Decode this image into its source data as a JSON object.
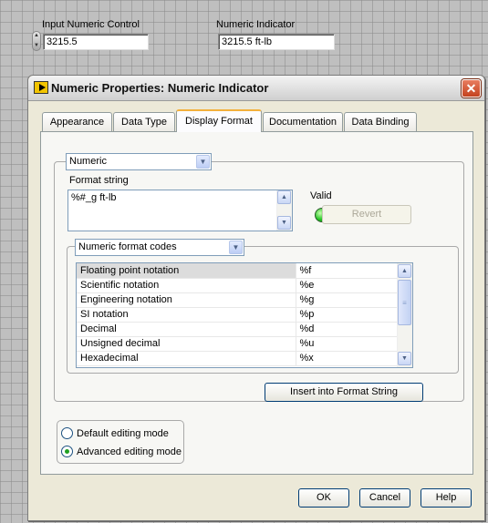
{
  "front_panel": {
    "control_label": "Input Numeric Control",
    "control_value": "3215.5",
    "indicator_label": "Numeric Indicator",
    "indicator_value": "3215.5 ft-lb"
  },
  "dialog": {
    "title": "Numeric Properties: Numeric Indicator",
    "close_glyph": "✕",
    "tabs": [
      "Appearance",
      "Data Type",
      "Display Format",
      "Documentation",
      "Data Binding"
    ],
    "active_tab": "Display Format",
    "type_select": "Numeric",
    "format_string_label": "Format string",
    "format_string_value": "%#_g ft-lb",
    "valid_label": "Valid",
    "valid_led_color": "#22c322",
    "revert_label": "Revert",
    "codes_select": "Numeric format codes",
    "format_codes": [
      {
        "name": "Floating point notation",
        "code": "%f"
      },
      {
        "name": "Scientific notation",
        "code": "%e"
      },
      {
        "name": "Engineering notation",
        "code": "%g"
      },
      {
        "name": "SI notation",
        "code": "%p"
      },
      {
        "name": "Decimal",
        "code": "%d"
      },
      {
        "name": "Unsigned decimal",
        "code": "%u"
      },
      {
        "name": "Hexadecimal",
        "code": "%x"
      }
    ],
    "insert_label": "Insert into Format String",
    "edit_modes": [
      {
        "label": "Default editing mode",
        "checked": false
      },
      {
        "label": "Advanced editing mode",
        "checked": true
      }
    ],
    "ok_label": "OK",
    "cancel_label": "Cancel",
    "help_label": "Help"
  }
}
